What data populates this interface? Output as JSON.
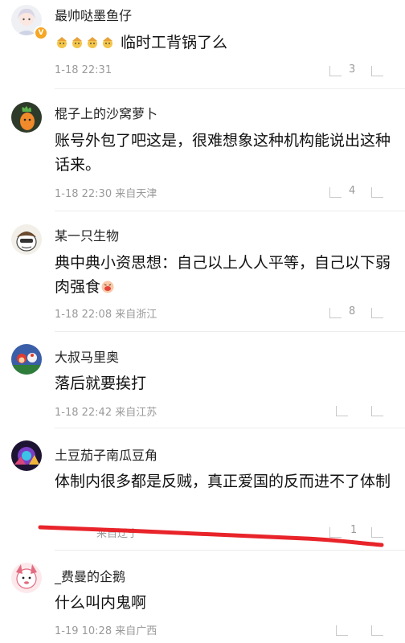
{
  "comments": [
    {
      "name": "最帅哒墨鱼仔",
      "text": "临时工背锅了么",
      "time": "1-18 22:31",
      "location": "",
      "count": "3",
      "avatar_icon": "anime-girl-avatar-icon",
      "verified": true,
      "emoji_prefix": "craftsman-emoji-x4"
    },
    {
      "name": "棍子上的沙窝萝卜",
      "text": "账号外包了吧这是，很难想象这种机构能说出这种话来。",
      "time": "1-18 22:30",
      "location": "来自天津",
      "count": "4",
      "avatar_icon": "radish-avatar-icon"
    },
    {
      "name": "某一只生物",
      "text": "典中典小资思想：自己以上人人平等，自己以下弱肉强食",
      "time": "1-18 22:08",
      "location": "来自浙江",
      "count": "8",
      "avatar_icon": "cartoon-creature-avatar-icon",
      "emoji_suffix": "drooling-face-emoji"
    },
    {
      "name": "大叔马里奥",
      "text": "落后就要挨打",
      "time": "1-18 22:42",
      "location": "来自江苏",
      "count": "",
      "avatar_icon": "mario-avatar-icon"
    },
    {
      "name": "土豆茄子南瓜豆角",
      "text": "体制内很多都是反贼，真正爱国的反而进不了体制",
      "time": "",
      "location": "来自辽宁",
      "count": "1",
      "avatar_icon": "game-art-avatar-icon"
    },
    {
      "name": "_费曼的企鹅",
      "text": "什么叫内鬼啊",
      "time": "1-19 10:28",
      "location": "来自广西",
      "count": "",
      "avatar_icon": "penguin-avatar-icon"
    }
  ],
  "colors": {
    "annotation_red": "#e8242a",
    "meta_gray": "#9a9a9a",
    "divider": "#ececec"
  }
}
